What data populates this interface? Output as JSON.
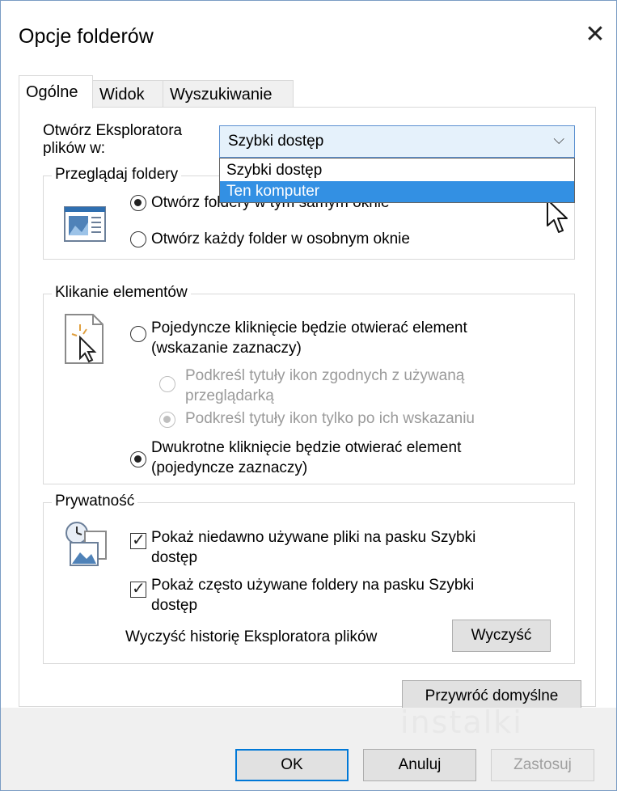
{
  "window": {
    "title": "Opcje folderów",
    "close_glyph": "✕"
  },
  "tabs": [
    {
      "label": "Ogólne",
      "active": true
    },
    {
      "label": "Widok",
      "active": false
    },
    {
      "label": "Wyszukiwanie",
      "active": false
    }
  ],
  "open_explorer": {
    "label_line1": "Otwórz Eksploratora",
    "label_line2": "plików w:",
    "selected_value": "Szybki dostęp",
    "chevron": "⌵",
    "options": [
      "Szybki dostęp",
      "Ten komputer"
    ],
    "highlighted_option": "Ten komputer"
  },
  "browse_folders": {
    "title": "Przeglądaj foldery",
    "option_same_window": "Otwórz foldery w tym samym oknie",
    "option_new_window": "Otwórz każdy folder w osobnym oknie",
    "selected": "same_window"
  },
  "click_items": {
    "title": "Klikanie elementów",
    "single_click_line1": "Pojedyncze kliknięcie będzie otwierać element",
    "single_click_line2": "(wskazanie zaznaczy)",
    "underline_browser_line1": "Podkreśl tytuły ikon zgodnych z używaną",
    "underline_browser_line2": "przeglądarką",
    "underline_hover": "Podkreśl tytuły ikon tylko po ich wskazaniu",
    "double_click_line1": "Dwukrotne kliknięcie będzie otwierać element",
    "double_click_line2": "(pojedyncze zaznaczy)",
    "selected": "double_click"
  },
  "privacy": {
    "title": "Prywatność",
    "recent_files_line1": "Pokaż niedawno używane pliki na pasku Szybki",
    "recent_files_line2": "dostęp",
    "frequent_folders_line1": "Pokaż często używane foldery na pasku Szybki",
    "frequent_folders_line2": "dostęp",
    "recent_files_checked": true,
    "frequent_folders_checked": true,
    "check_glyph": "✓",
    "clear_history_label": "Wyczyść historię Eksploratora plików",
    "clear_button": "Wyczyść"
  },
  "restore_defaults_button": "Przywróć domyślne",
  "watermark": "instalki",
  "footer": {
    "ok": "OK",
    "cancel": "Anuluj",
    "apply": "Zastosuj"
  },
  "colors": {
    "accent": "#0078d7",
    "dropdown_highlight": "#3390e3",
    "combo_hover_bg": "#e5f1fb"
  }
}
